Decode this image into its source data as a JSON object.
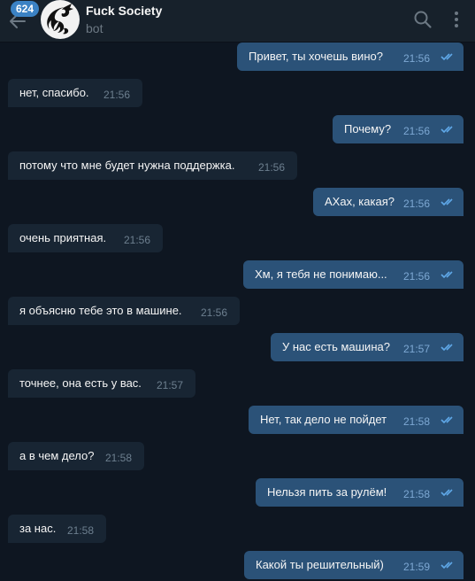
{
  "header": {
    "badge": "624",
    "title": "Fuck Society",
    "subtitle": "bot"
  },
  "messages": [
    {
      "dir": "out",
      "text": "Привет, ты хочешь вино?",
      "time": "21:56"
    },
    {
      "dir": "in",
      "text": "нет, спасибо.",
      "time": "21:56"
    },
    {
      "dir": "out",
      "text": "Почему?",
      "time": "21:56"
    },
    {
      "dir": "in",
      "text": "потому что мне будет нужна поддержка.",
      "time": "21:56"
    },
    {
      "dir": "out",
      "text": "АХах, какая?",
      "time": "21:56"
    },
    {
      "dir": "in",
      "text": "очень приятная.",
      "time": "21:56"
    },
    {
      "dir": "out",
      "text": "Хм, я тебя не понимаю...",
      "time": "21:56"
    },
    {
      "dir": "in",
      "text": "я объясню тебе это в машине.",
      "time": "21:56"
    },
    {
      "dir": "out",
      "text": "У нас есть машина?",
      "time": "21:57"
    },
    {
      "dir": "in",
      "text": "точнее, она есть у вас.",
      "time": "21:57"
    },
    {
      "dir": "out",
      "text": "Нет, так дело не пойдет",
      "time": "21:58"
    },
    {
      "dir": "in",
      "text": "а в чем дело?",
      "time": "21:58"
    },
    {
      "dir": "out",
      "text": "Нельзя пить за рулём!",
      "time": "21:58"
    },
    {
      "dir": "in",
      "text": "за нас.",
      "time": "21:58"
    },
    {
      "dir": "out",
      "text": "Какой ты решительный)",
      "time": "21:59"
    }
  ],
  "colors": {
    "background": "#0e1621",
    "header": "#17212b",
    "incoming_bubble": "#182533",
    "outgoing_bubble": "#2b5278",
    "read_check": "#5fa8e8",
    "badge": "#3b82c4"
  }
}
